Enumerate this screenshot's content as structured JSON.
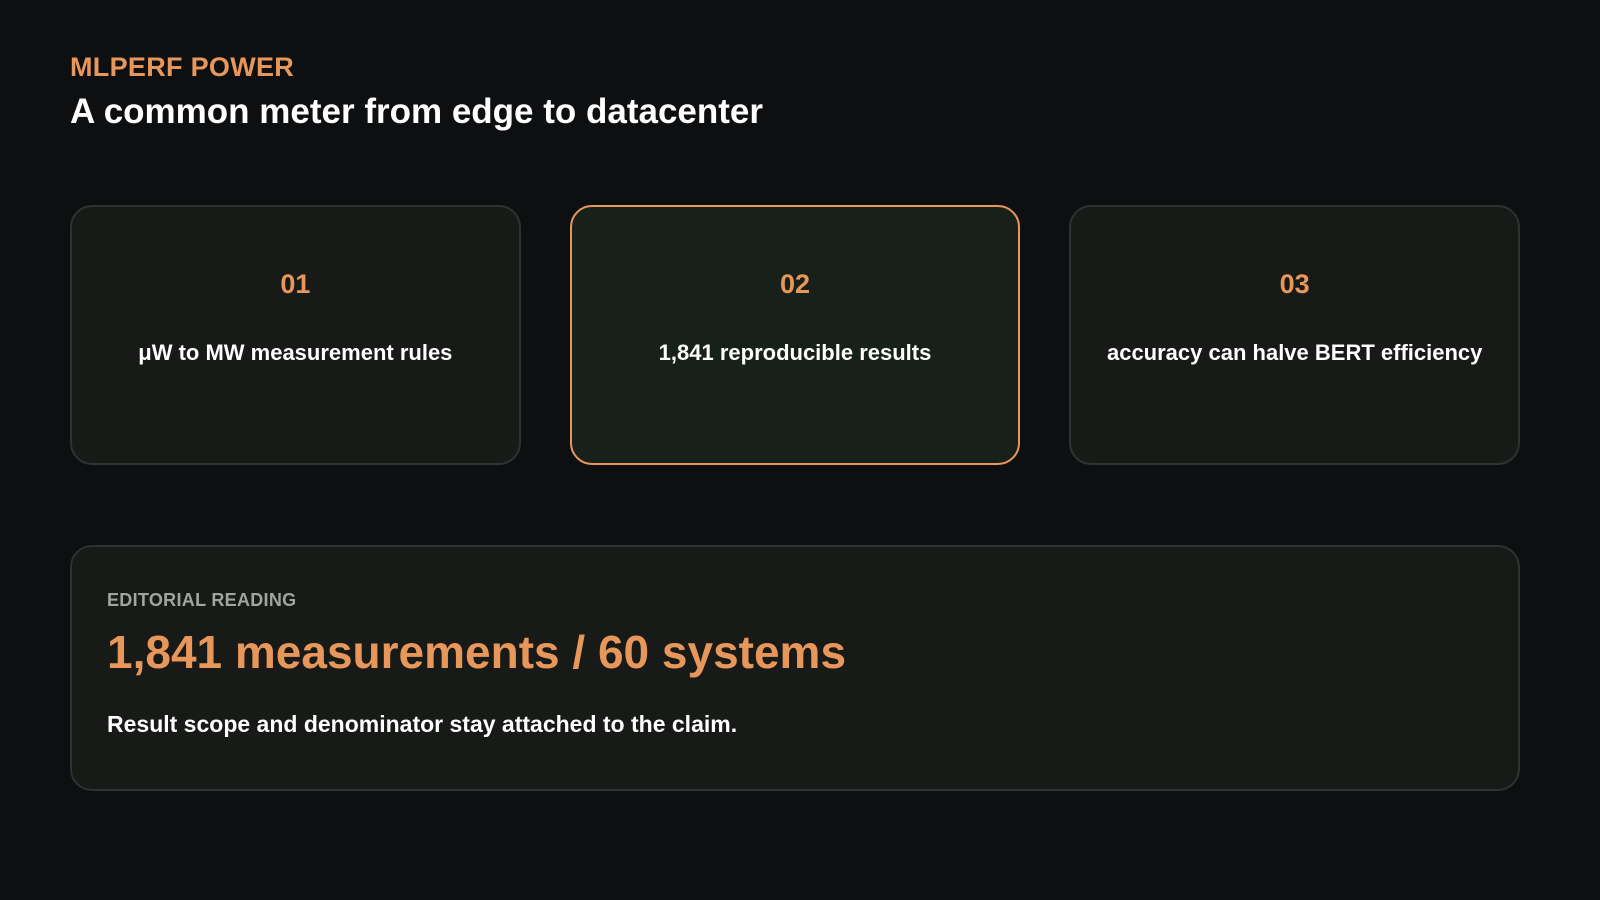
{
  "header": {
    "kicker": "MLPERF POWER",
    "title": "A common meter from edge to datacenter"
  },
  "cards": [
    {
      "number": "01",
      "text": "μW to MW measurement rules",
      "highlighted": false
    },
    {
      "number": "02",
      "text": "1,841 reproducible results",
      "highlighted": true
    },
    {
      "number": "03",
      "text": "accuracy can halve BERT efficiency",
      "highlighted": false
    }
  ],
  "editorial": {
    "label": "EDITORIAL READING",
    "headline": "1,841 measurements / 60 systems",
    "body": "Result scope and denominator stay attached to the claim."
  },
  "colors": {
    "background": "#0e0f11",
    "accent": "#e8975a",
    "card": "#181a18",
    "card_highlight": "#182119",
    "text": "#ffffff",
    "muted": "#a1a5a1"
  }
}
